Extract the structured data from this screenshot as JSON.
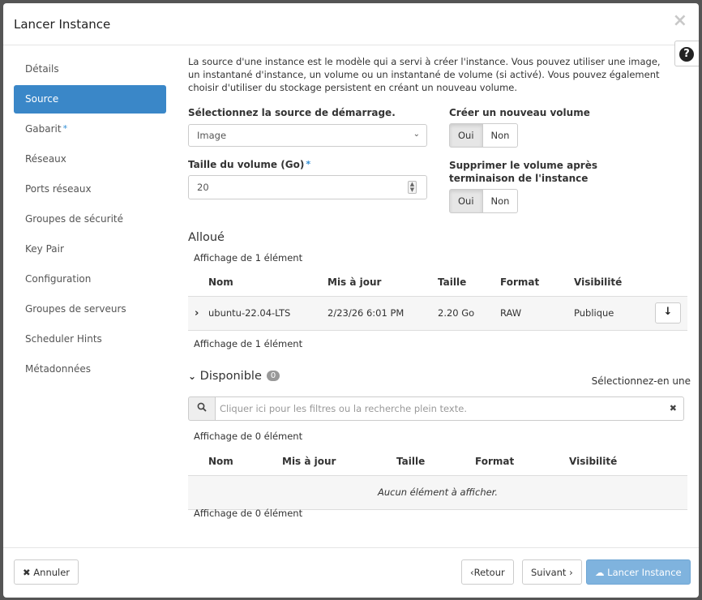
{
  "modal": {
    "title": "Lancer Instance",
    "close_icon": "×",
    "help_icon": "?"
  },
  "sidebar": {
    "items": [
      {
        "label": "Détails",
        "required": false,
        "active": false
      },
      {
        "label": "Source",
        "required": false,
        "active": true
      },
      {
        "label": "Gabarit",
        "required": true,
        "active": false
      },
      {
        "label": "Réseaux",
        "required": false,
        "active": false
      },
      {
        "label": "Ports réseaux",
        "required": false,
        "active": false
      },
      {
        "label": "Groupes de sécurité",
        "required": false,
        "active": false
      },
      {
        "label": "Key Pair",
        "required": false,
        "active": false
      },
      {
        "label": "Configuration",
        "required": false,
        "active": false
      },
      {
        "label": "Groupes de serveurs",
        "required": false,
        "active": false
      },
      {
        "label": "Scheduler Hints",
        "required": false,
        "active": false
      },
      {
        "label": "Métadonnées",
        "required": false,
        "active": false
      }
    ],
    "required_marker": "*"
  },
  "main": {
    "intro": "La source d'une instance est le modèle qui a servi à créer l'instance. Vous pouvez utiliser une image, un instantané d'instance, un volume ou un instantané de volume (si activé). Vous pouvez également choisir d'utiliser du stockage persistent en créant un nouveau volume.",
    "boot_source": {
      "label": "Sélectionnez la source de démarrage.",
      "value": "Image"
    },
    "volume_size": {
      "label": "Taille du volume (Go)",
      "required_marker": "*",
      "value": "20"
    },
    "create_volume": {
      "label": "Créer un nouveau volume",
      "yes": "Oui",
      "no": "Non",
      "selected": "Oui"
    },
    "delete_volume": {
      "label": "Supprimer le volume après terminaison de l'instance",
      "yes": "Oui",
      "no": "Non",
      "selected": "Oui"
    },
    "allocated": {
      "title": "Alloué",
      "count_text": "Affichage de 1 élément",
      "columns": [
        "Nom",
        "Mis à jour",
        "Taille",
        "Format",
        "Visibilité"
      ],
      "rows": [
        {
          "name": "ubuntu-22.04-LTS",
          "updated": "2/23/26 6:01 PM",
          "size": "2.20 Go",
          "format": "RAW",
          "visibility": "Publique"
        }
      ]
    },
    "available": {
      "title": "Disponible",
      "badge": "0",
      "select_one": "Sélectionnez-en une",
      "search_placeholder": "Cliquer ici pour les filtres ou la recherche plein texte.",
      "count_text": "Affichage de 0 élément",
      "columns": [
        "Nom",
        "Mis à jour",
        "Taille",
        "Format",
        "Visibilité"
      ],
      "empty_text": "Aucun élément à afficher."
    }
  },
  "footer": {
    "cancel": "Annuler",
    "back": "Retour",
    "next": "Suivant",
    "launch": "Lancer Instance"
  },
  "colors": {
    "accent": "#3a87c8",
    "primary_disabled": "#7fb3de"
  }
}
